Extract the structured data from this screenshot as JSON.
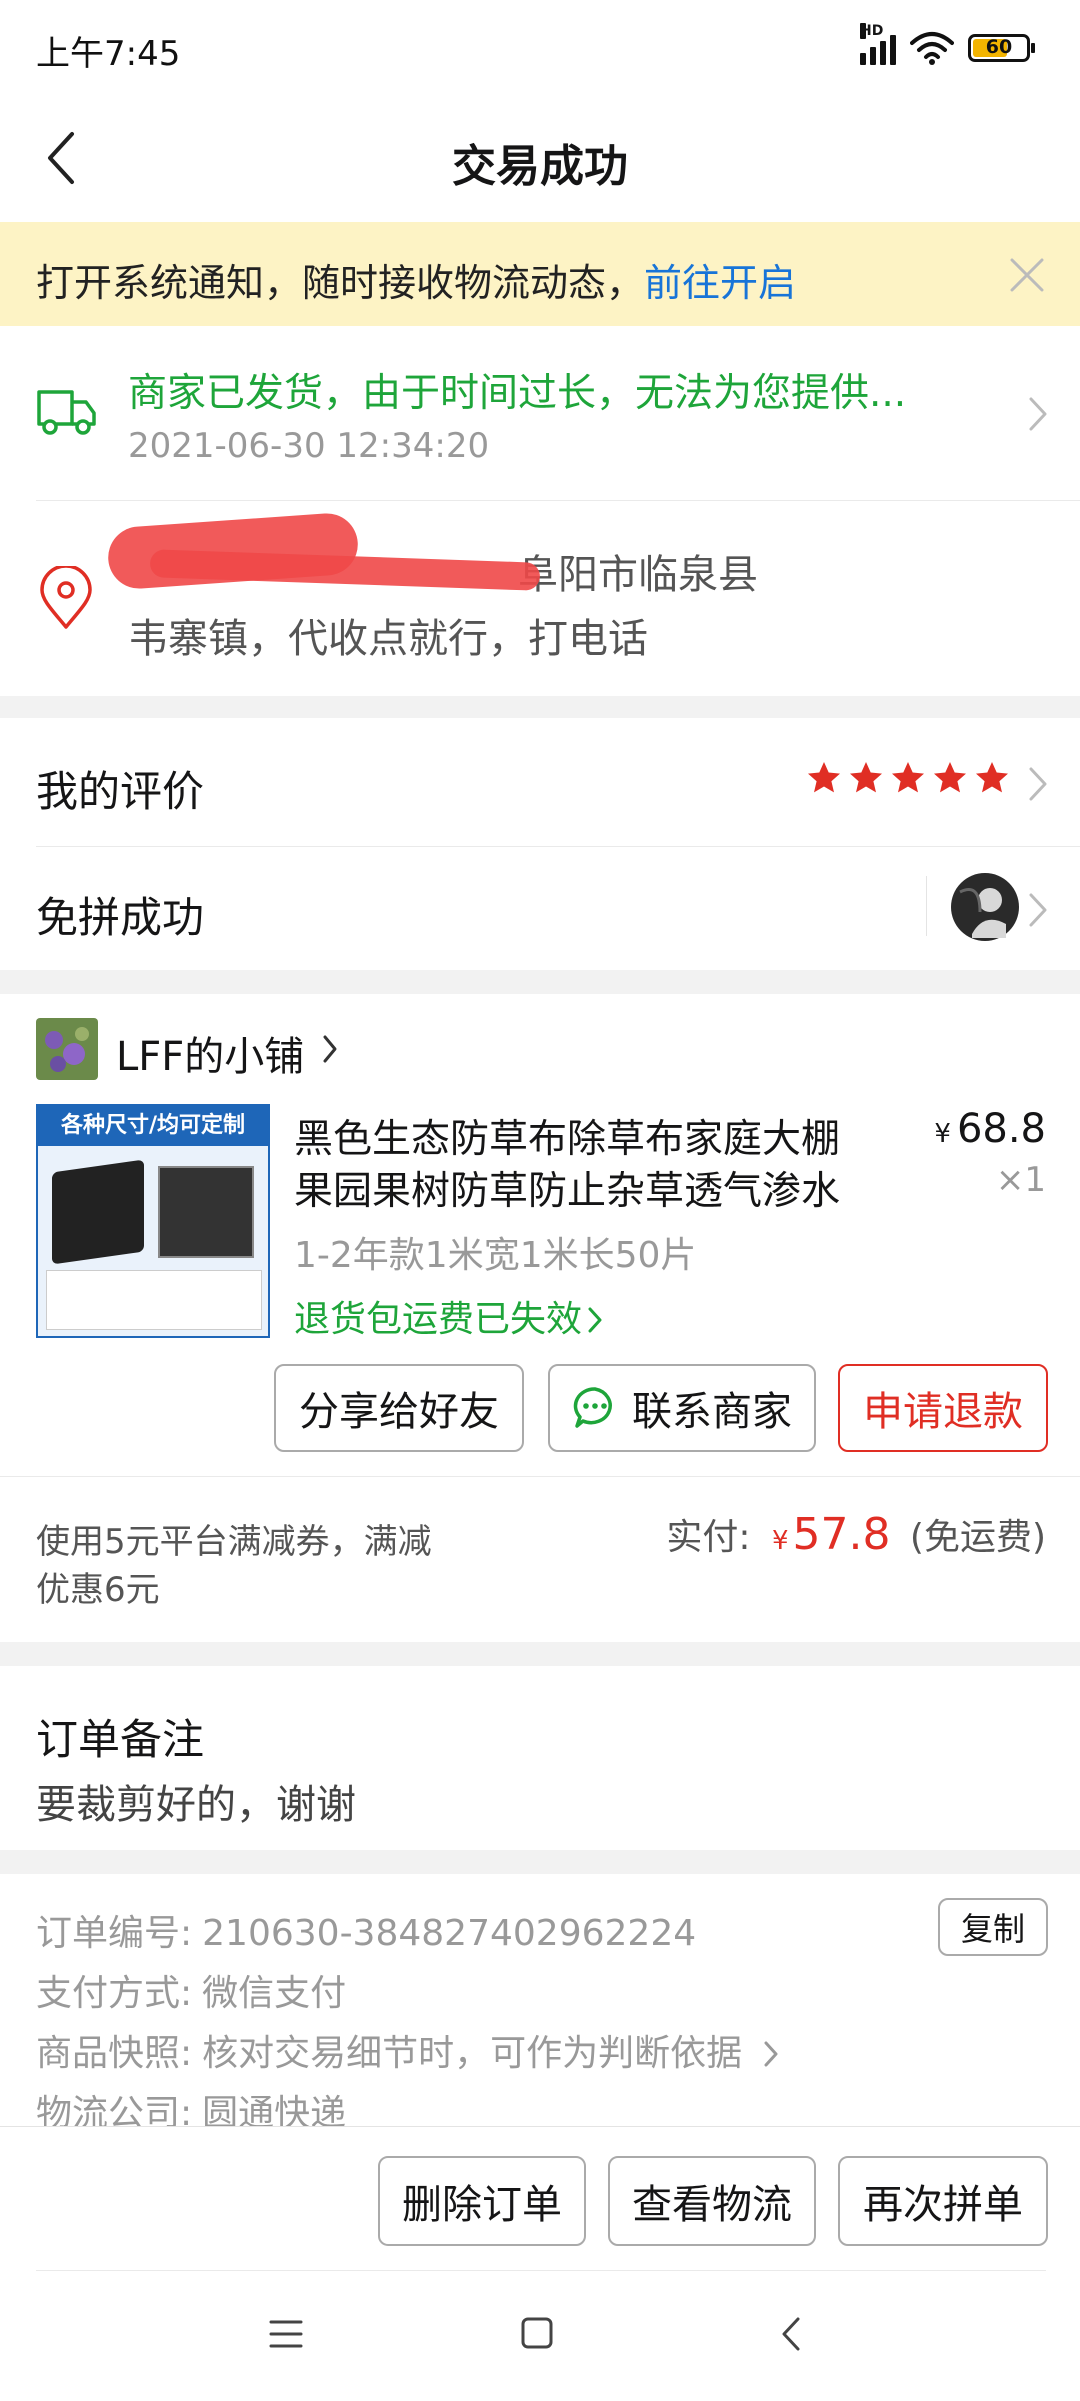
{
  "status": {
    "time": "上午7:45",
    "network": "HD",
    "battery": "60"
  },
  "nav": {
    "title": "交易成功"
  },
  "notice": {
    "text": "打开系统通知，随时接收物流动态，",
    "link": "前往开启"
  },
  "logistics": {
    "status": "商家已发货，由于时间过长，无法为您提供...",
    "time": "2021-06-30 12:34:20"
  },
  "address": {
    "line1": "阜阳市临泉县",
    "line2": "韦寨镇，代收点就行，打电话"
  },
  "review": {
    "label": "我的评价",
    "stars": 5
  },
  "group": {
    "label": "免拼成功"
  },
  "shop": {
    "name": "LFF的小铺"
  },
  "product": {
    "thumb_header": "各种尺寸/均可定制",
    "title_line1": "黑色生态防草布除草布家庭大棚",
    "title_line2": "果园果树防草防止杂草透气渗水",
    "spec": "1-2年款1米宽1米长50片",
    "return_note": "退货包运费已失效",
    "currency": "¥",
    "price": "68.8",
    "qty": "×1"
  },
  "actions": {
    "share": "分享给好友",
    "contact": "联系商家",
    "refund": "申请退款"
  },
  "payment": {
    "coupon_line1": "使用5元平台满减券，满减",
    "coupon_line2": "优惠6元",
    "paid_label": "实付:",
    "currency": "¥",
    "paid": "57.8",
    "shipping": "(免运费)"
  },
  "remark": {
    "title": "订单备注",
    "text": "要裁剪好的，谢谢"
  },
  "order": {
    "no_label": "订单编号:",
    "no": "210630-384827402962224",
    "copy": "复制",
    "pay_label": "支付方式:",
    "pay": "微信支付",
    "snapshot_label": "商品快照:",
    "snapshot": "核对交易细节时，可作为判断依据",
    "courier_label": "物流公司:",
    "courier": "圆通快递"
  },
  "bottom": {
    "delete": "删除订单",
    "track": "查看物流",
    "reorder": "再次拼单"
  },
  "colors": {
    "green": "#1ea53a",
    "red": "#e02e24",
    "link": "#1774d8",
    "notice_bg": "#fdf3c5"
  }
}
